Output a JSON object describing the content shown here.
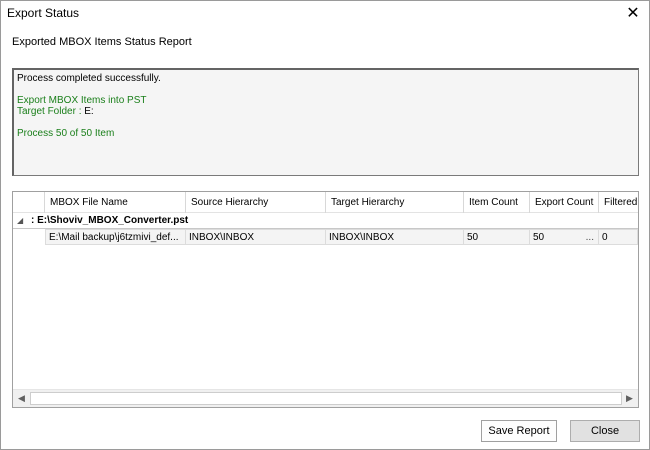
{
  "window": {
    "title": "Export Status",
    "close_glyph": "✕"
  },
  "report_title": "Exported MBOX Items Status Report",
  "log": {
    "line1": "Process completed successfully.",
    "line2": "Export MBOX Items into PST",
    "line3_label": "Target Folder : ",
    "line3_value": "E:",
    "line4": "Process 50 of 50 Item"
  },
  "grid": {
    "columns": [
      "MBOX File Name",
      "Source Hierarchy",
      "Target Hierarchy",
      "Item Count",
      "Export Count",
      "Filtered"
    ],
    "group": {
      "expander": "◢",
      "label": ": E:\\Shoviv_MBOX_Converter.pst"
    },
    "rows": [
      {
        "file_name": "E:\\Mail backup\\j6tzmivi_def...",
        "source": "INBOX\\INBOX",
        "target": "INBOX\\INBOX",
        "item_count": "50",
        "export_count": "50",
        "export_dots": "...",
        "filtered": "0"
      }
    ],
    "scroll_left": "◀",
    "scroll_right": "▶"
  },
  "buttons": {
    "save_report": "Save Report",
    "close": "Close"
  },
  "colors": {
    "log_green": "#1a7f1a"
  }
}
